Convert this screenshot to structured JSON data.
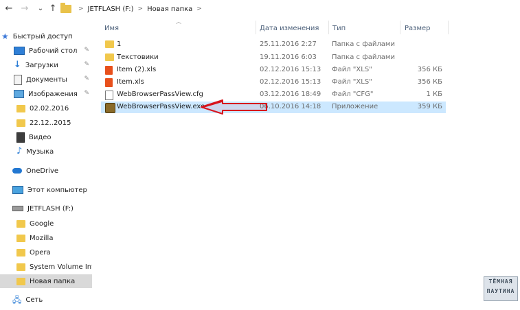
{
  "address_bar": {
    "back": "←",
    "forward": "→",
    "recent": "⌄",
    "up": "↑",
    "path": [
      "JETFLASH (F:)",
      "Новая папка"
    ]
  },
  "sidebar": {
    "items": [
      {
        "label": "Быстрый доступ",
        "icon": "star-icon"
      },
      {
        "label": "Рабочий стол",
        "icon": "desktop-icon",
        "pinned": true
      },
      {
        "label": "Загрузки",
        "icon": "download-icon",
        "pinned": true
      },
      {
        "label": "Документы",
        "icon": "documents-icon",
        "pinned": true
      },
      {
        "label": "Изображения",
        "icon": "pictures-icon",
        "pinned": true
      },
      {
        "label": "02.02.2016",
        "icon": "folder-icon"
      },
      {
        "label": "22.12..2015",
        "icon": "folder-icon"
      },
      {
        "label": "Видео",
        "icon": "video-icon"
      },
      {
        "label": "Музыка",
        "icon": "music-icon"
      },
      {
        "label": "OneDrive",
        "icon": "onedrive-icon"
      },
      {
        "label": "Этот компьютер",
        "icon": "computer-icon"
      },
      {
        "label": "JETFLASH (F:)",
        "icon": "drive-icon"
      },
      {
        "label": "Google",
        "icon": "folder-icon"
      },
      {
        "label": "Mozilla",
        "icon": "folder-icon"
      },
      {
        "label": "Opera",
        "icon": "folder-icon"
      },
      {
        "label": "System Volume Info",
        "icon": "folder-icon"
      },
      {
        "label": "Новая папка",
        "icon": "folder-icon",
        "selected": true
      },
      {
        "label": "Сеть",
        "icon": "network-icon"
      }
    ]
  },
  "columns": {
    "name": "Имя",
    "date": "Дата изменения",
    "type": "Тип",
    "size": "Размер"
  },
  "files": [
    {
      "name": "1",
      "date": "25.11.2016 2:27",
      "type": "Папка с файлами",
      "size": "",
      "icon": "folder-icon"
    },
    {
      "name": "Текстовики",
      "date": "19.11.2016 6:03",
      "type": "Папка с файлами",
      "size": "",
      "icon": "folder-icon"
    },
    {
      "name": "Item (2).xls",
      "date": "02.12.2016 15:13",
      "type": "Файл \"XLS\"",
      "size": "356 КБ",
      "icon": "xls-icon"
    },
    {
      "name": "Item.xls",
      "date": "02.12.2016 15:13",
      "type": "Файл \"XLS\"",
      "size": "356 КБ",
      "icon": "xls-icon"
    },
    {
      "name": "WebBrowserPassView.cfg",
      "date": "03.12.2016 18:49",
      "type": "Файл \"CFG\"",
      "size": "1 КБ",
      "icon": "cfg-icon"
    },
    {
      "name": "WebBrowserPassView.exe",
      "date": "06.10.2016 14:18",
      "type": "Приложение",
      "size": "359 КБ",
      "icon": "exe-icon",
      "selected": true
    }
  ],
  "watermark": [
    "ТЁМНАЯ",
    "ПАУТИНА"
  ],
  "colors": {
    "selection": "#cce8ff",
    "arrow": "#d8141c",
    "folder": "#f1c84c"
  }
}
